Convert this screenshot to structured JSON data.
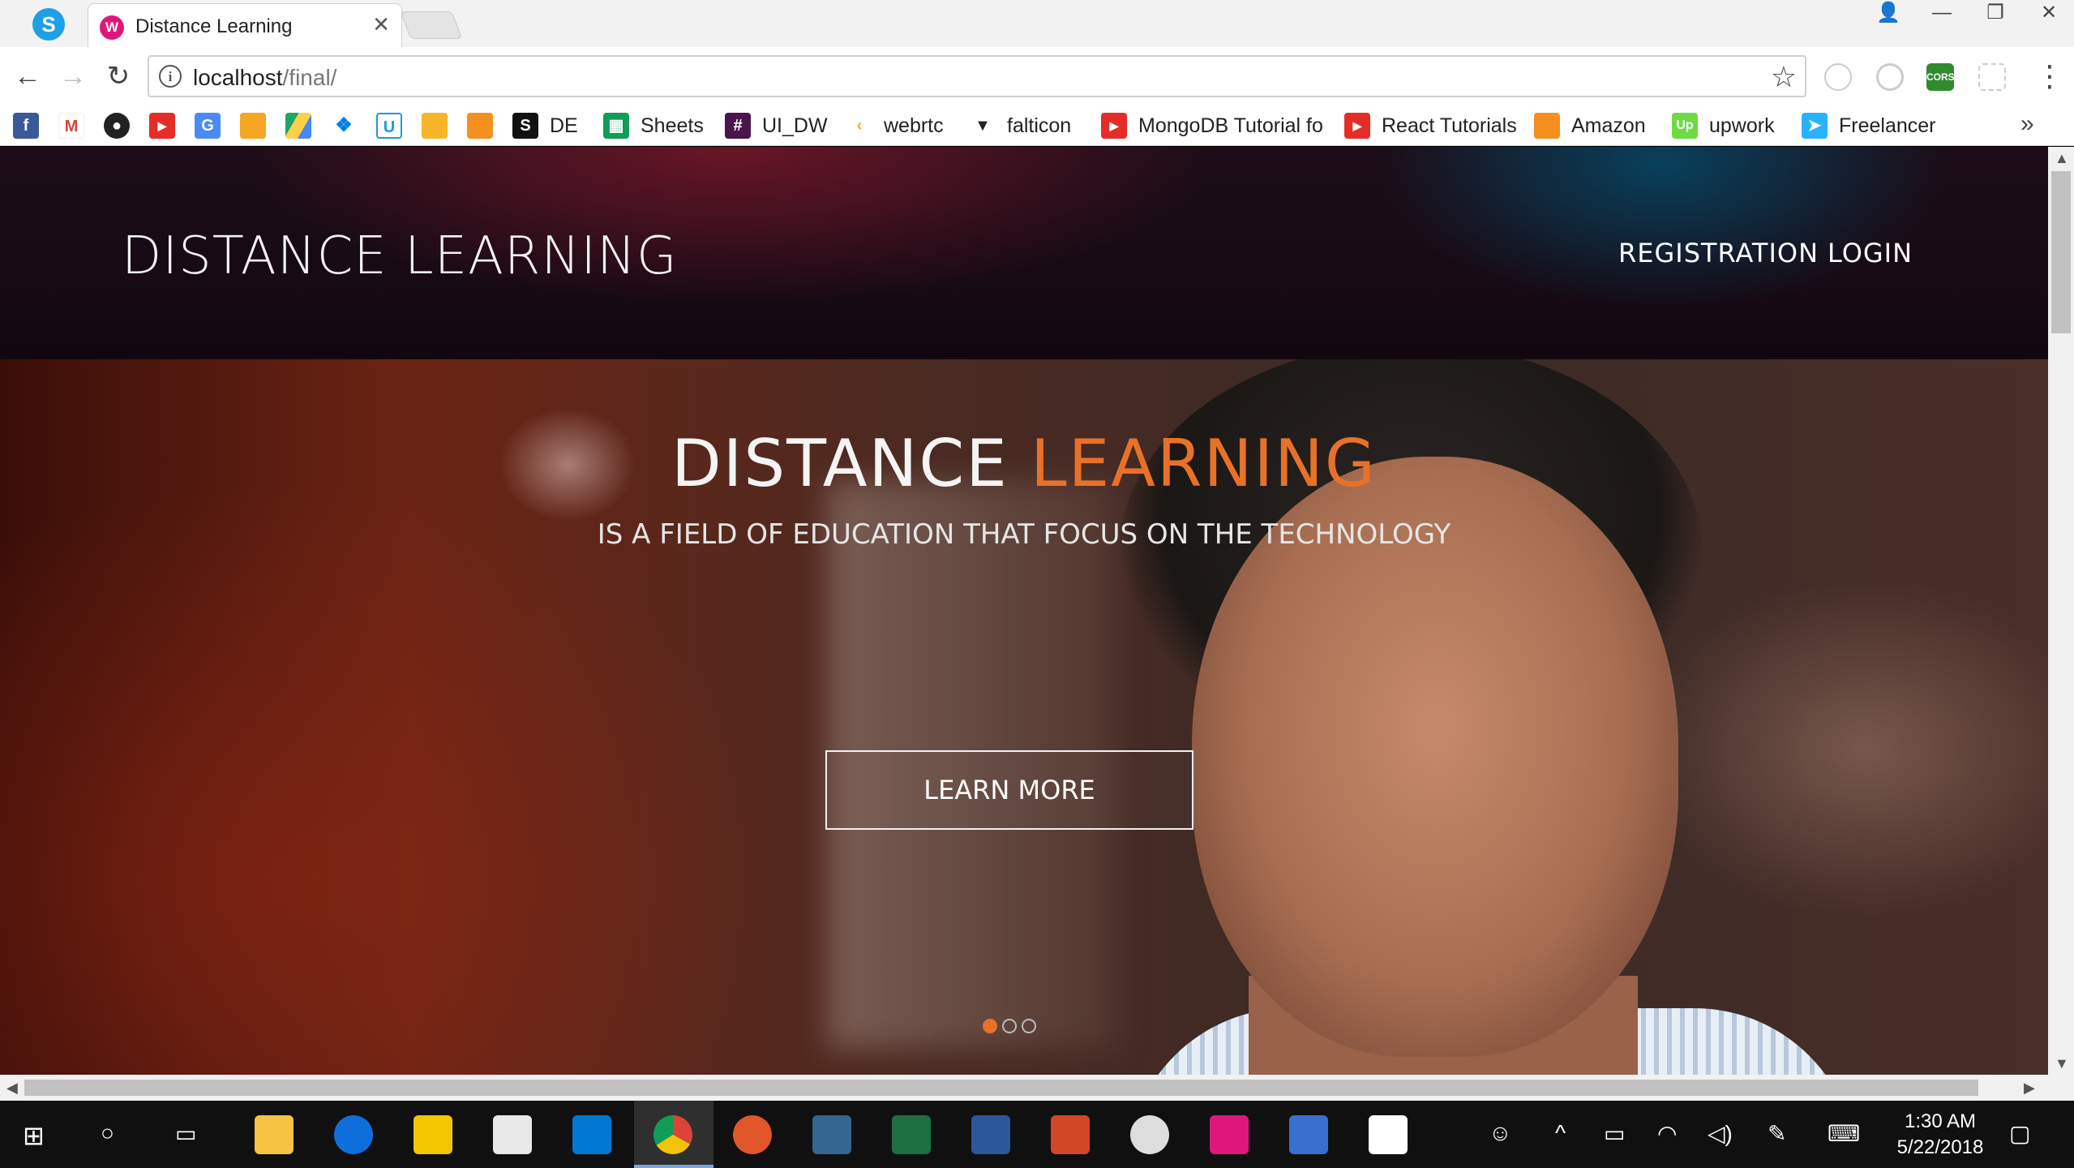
{
  "browser": {
    "tabs": [
      {
        "title": "Distance Learning",
        "close": "✕"
      }
    ],
    "window_controls": {
      "profile": "👤",
      "minimize": "—",
      "restore": "❐",
      "close": "✕"
    },
    "nav": {
      "back": "←",
      "forward": "→",
      "reload": "↻"
    },
    "url": {
      "host": "localhost",
      "path": "/final/"
    },
    "menu": "⋮",
    "bookmarks": [
      {
        "label": "DE"
      },
      {
        "label": "Sheets"
      },
      {
        "label": "UI_DW"
      },
      {
        "label": "webrtc"
      },
      {
        "label": "falticon"
      },
      {
        "label": "MongoDB Tutorial fo"
      },
      {
        "label": "React Tutorials"
      },
      {
        "label": "Amazon"
      },
      {
        "label": "upwork"
      },
      {
        "label": "Freelancer"
      }
    ],
    "bookmarks_more": "»",
    "extension_labels": {
      "cors": "CORS"
    }
  },
  "site": {
    "brand": "DISTANCE LEARNING",
    "nav": {
      "registration": "REGISTRATION",
      "login": "LOGIN"
    },
    "hero": {
      "title_main": "DISTANCE ",
      "title_accent": "LEARNING",
      "subtitle": "IS A FIELD OF EDUCATION THAT FOCUS ON THE TECHNOLOGY",
      "cta": "LEARN MORE",
      "slide_count": 3,
      "active_slide": 1
    },
    "accent_color": "#e8712a"
  },
  "taskbar": {
    "time": "1:30 AM",
    "date": "5/22/2018"
  }
}
